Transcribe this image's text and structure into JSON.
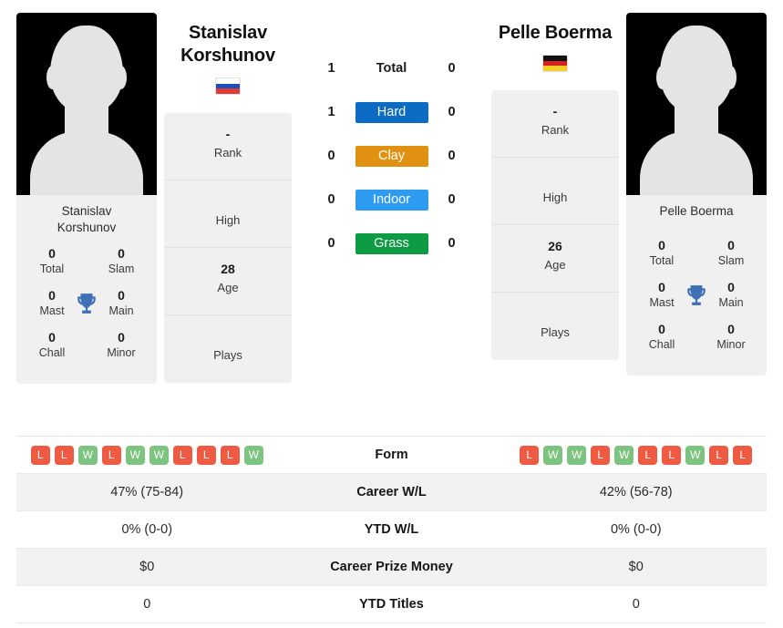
{
  "players": {
    "left": {
      "name": "Stanislav Korshunov",
      "name_line1": "Stanislav",
      "name_line2": "Korshunov",
      "photo_caption_line1": "Stanislav",
      "photo_caption_line2": "Korshunov",
      "country": "Russia",
      "flag_colors": [
        "#ffffff",
        "#1a4fbd",
        "#e03b37"
      ],
      "rank": "-",
      "rank_label": "Rank",
      "high": "",
      "high_label": "High",
      "age": "28",
      "age_label": "Age",
      "plays": "",
      "plays_label": "Plays",
      "titles": {
        "total": "0",
        "total_label": "Total",
        "slam": "0",
        "slam_label": "Slam",
        "mast": "0",
        "mast_label": "Mast",
        "main": "0",
        "main_label": "Main",
        "chall": "0",
        "chall_label": "Chall",
        "minor": "0",
        "minor_label": "Minor"
      },
      "form": [
        "L",
        "L",
        "W",
        "L",
        "W",
        "W",
        "L",
        "L",
        "L",
        "W"
      ],
      "career_wl": "47% (75-84)",
      "ytd_wl": "0% (0-0)",
      "career_prize_money": "$0",
      "ytd_titles": "0"
    },
    "right": {
      "name": "Pelle Boerma",
      "name_line1": "Pelle Boerma",
      "name_line2": "",
      "photo_caption_line1": "Pelle Boerma",
      "photo_caption_line2": "",
      "country": "Germany",
      "flag_colors": [
        "#111111",
        "#d91f21",
        "#f7ce2a"
      ],
      "rank": "-",
      "rank_label": "Rank",
      "high": "",
      "high_label": "High",
      "age": "26",
      "age_label": "Age",
      "plays": "",
      "plays_label": "Plays",
      "titles": {
        "total": "0",
        "total_label": "Total",
        "slam": "0",
        "slam_label": "Slam",
        "mast": "0",
        "mast_label": "Mast",
        "main": "0",
        "main_label": "Main",
        "chall": "0",
        "chall_label": "Chall",
        "minor": "0",
        "minor_label": "Minor"
      },
      "form": [
        "L",
        "W",
        "W",
        "L",
        "W",
        "L",
        "L",
        "W",
        "L",
        "L"
      ],
      "career_wl": "42% (56-78)",
      "ytd_wl": "0% (0-0)",
      "career_prize_money": "$0",
      "ytd_titles": "0"
    }
  },
  "h2h": {
    "rows": [
      {
        "label": "Total",
        "left": "1",
        "right": "0",
        "badge": false,
        "color": ""
      },
      {
        "label": "Hard",
        "left": "1",
        "right": "0",
        "badge": true,
        "color": "#0c6cc4"
      },
      {
        "label": "Clay",
        "left": "0",
        "right": "0",
        "badge": true,
        "color": "#e09112"
      },
      {
        "label": "Indoor",
        "left": "0",
        "right": "0",
        "badge": true,
        "color": "#2d9cf0"
      },
      {
        "label": "Grass",
        "left": "0",
        "right": "0",
        "badge": true,
        "color": "#0d9b43"
      }
    ]
  },
  "comparison": {
    "rows": [
      {
        "label": "Form",
        "type": "form"
      },
      {
        "label": "Career W/L",
        "type": "text",
        "key": "career_wl"
      },
      {
        "label": "YTD W/L",
        "type": "text",
        "key": "ytd_wl"
      },
      {
        "label": "Career Prize Money",
        "type": "text",
        "key": "career_prize_money"
      },
      {
        "label": "YTD Titles",
        "type": "text",
        "key": "ytd_titles"
      }
    ]
  },
  "colors": {
    "win_badge": "#7cc47f",
    "loss_badge": "#ef5a43",
    "trophy": "#3f6fb5",
    "card_bg": "#f0f0f0",
    "row_shaded": "#f2f2f2"
  }
}
